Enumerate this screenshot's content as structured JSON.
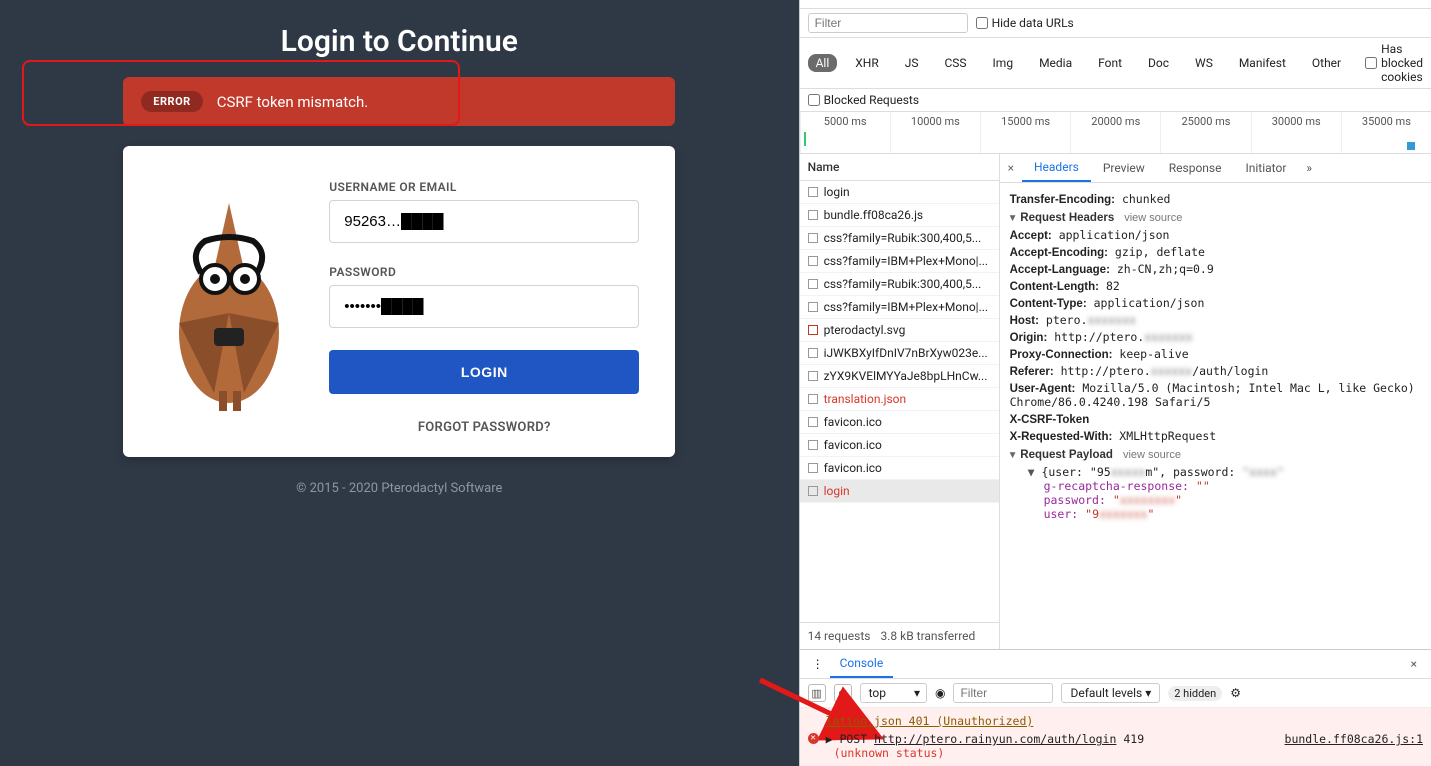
{
  "login": {
    "title": "Login to Continue",
    "error_badge": "ERROR",
    "error_msg": "CSRF token mismatch.",
    "username_label": "USERNAME OR EMAIL",
    "username_value": "95263…████",
    "password_label": "PASSWORD",
    "password_value": "•••••••████",
    "login_btn": "LOGIN",
    "forgot": "FORGOT PASSWORD?",
    "footer": "© 2015 - 2020 Pterodactyl Software"
  },
  "devtools": {
    "filter_placeholder": "Filter",
    "hide_data_urls": "Hide data URLs",
    "chips": [
      "All",
      "XHR",
      "JS",
      "CSS",
      "Img",
      "Media",
      "Font",
      "Doc",
      "WS",
      "Manifest",
      "Other"
    ],
    "blocked_cookies": "Has blocked cookies",
    "blocked_requests": "Blocked Requests",
    "ticks": [
      "5000 ms",
      "10000 ms",
      "15000 ms",
      "20000 ms",
      "25000 ms",
      "30000 ms",
      "35000 ms"
    ],
    "name_header": "Name",
    "requests": [
      {
        "n": "login",
        "err": false
      },
      {
        "n": "bundle.ff08ca26.js",
        "err": false
      },
      {
        "n": "css?family=Rubik:300,400,5...",
        "err": false
      },
      {
        "n": "css?family=IBM+Plex+Mono|...",
        "err": false
      },
      {
        "n": "css?family=Rubik:300,400,5...",
        "err": false
      },
      {
        "n": "css?family=IBM+Plex+Mono|...",
        "err": false
      },
      {
        "n": "pterodactyl.svg",
        "err": false,
        "img": true
      },
      {
        "n": "iJWKBXyIfDnIV7nBrXyw023e...",
        "err": false
      },
      {
        "n": "zYX9KVElMYYaJe8bpLHnCw...",
        "err": false
      },
      {
        "n": "translation.json",
        "err": true
      },
      {
        "n": "favicon.ico",
        "err": false
      },
      {
        "n": "favicon.ico",
        "err": false
      },
      {
        "n": "favicon.ico",
        "err": false
      },
      {
        "n": "login",
        "err": true,
        "sel": true
      }
    ],
    "req_count": "14 requests",
    "xfer": "3.8 kB transferred",
    "dtabs": [
      "Headers",
      "Preview",
      "Response",
      "Initiator"
    ],
    "detail": {
      "transfer_encoding": "chunked",
      "req_hdr_title": "Request Headers",
      "view_source": "view source",
      "accept": "application/json",
      "accept_encoding": "gzip, deflate",
      "accept_language": "zh-CN,zh;q=0.9",
      "content_length": "82",
      "content_type": "application/json",
      "host": "ptero.██████",
      "origin": "http://ptero.██████",
      "proxy_connection": "keep-alive",
      "referer": "http://ptero.██████/auth/login",
      "user_agent": "Mozilla/5.0 (Macintosh; Intel Mac L, like Gecko) Chrome/86.0.4240.198 Safari/5",
      "x_csrf": "",
      "x_req_with": "XMLHttpRequest",
      "payload_title": "Request Payload",
      "payload_top": "{user: \"95██████m\", password: \"████\"",
      "p_grecaptcha_key": "g-recaptcha-response:",
      "p_grecaptcha_val": "\"\"",
      "p_password_key": "password:",
      "p_password_val": "\"██████\"",
      "p_user_key": "user:",
      "p_user_val": "\"9██████\""
    }
  },
  "console": {
    "tab": "Console",
    "context": "top",
    "filter_placeholder": "Filter",
    "levels": "Default levels",
    "hidden": "2 hidden",
    "line1": "lation.json 401 (Unauthorized)",
    "line2_method": "POST",
    "line2_url": "http://ptero.rainyun.com/auth/login",
    "line2_status": "419",
    "line2_src": "bundle.ff08ca26.js:1",
    "line2_sub": "(unknown status)"
  }
}
